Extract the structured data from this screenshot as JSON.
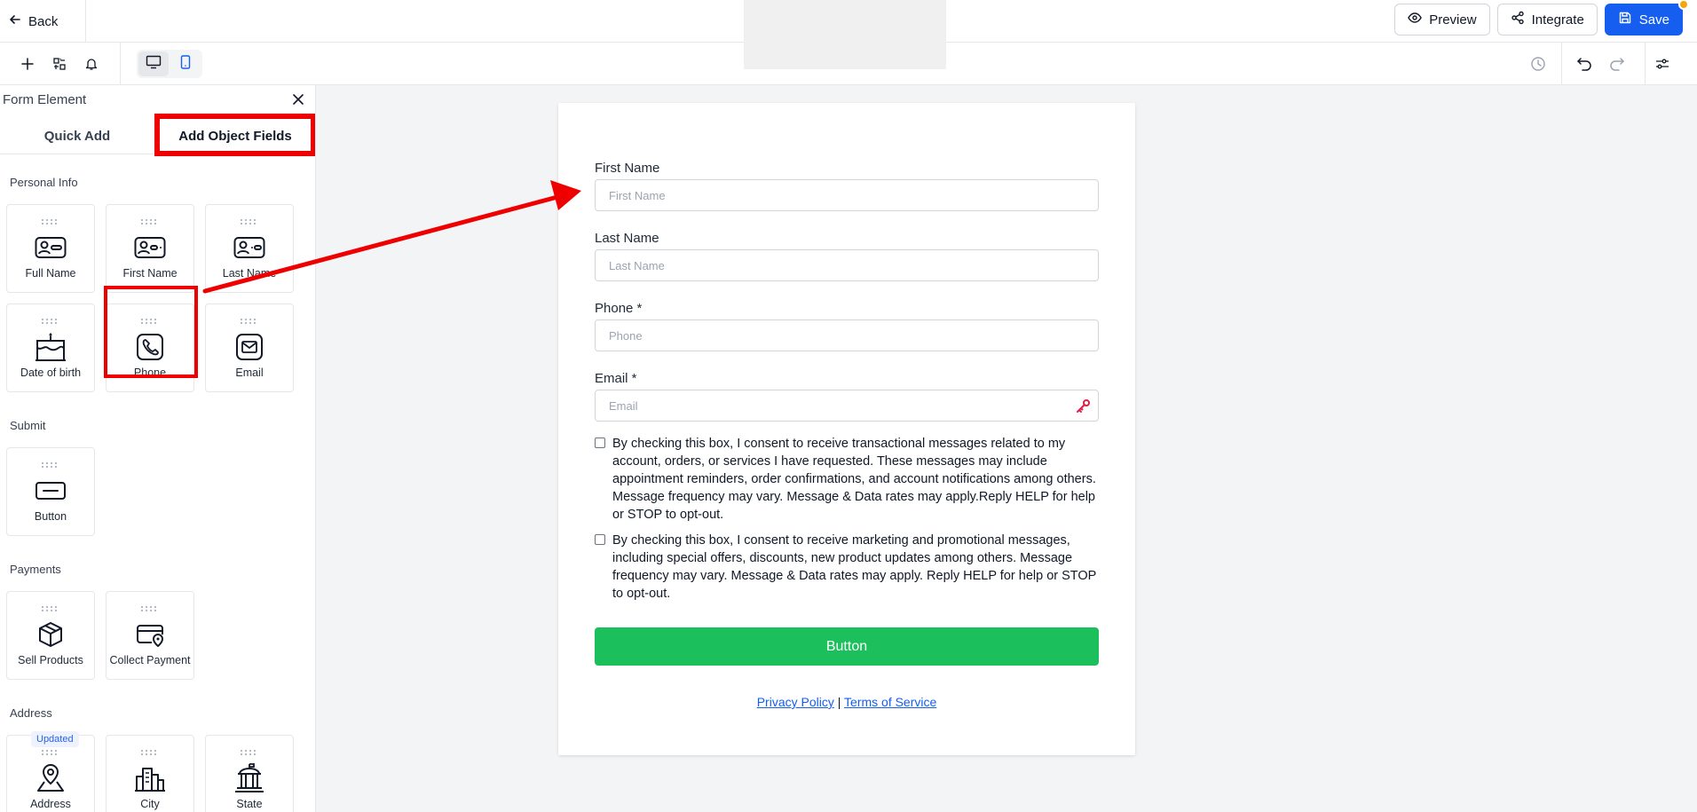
{
  "topbar": {
    "back_label": "Back",
    "preview_label": "Preview",
    "integrate_label": "Integrate",
    "save_label": "Save"
  },
  "sidebar": {
    "title": "Form Element",
    "tabs": [
      "Quick Add",
      "Add Object Fields"
    ],
    "active_tab": "Add Object Fields",
    "sections": {
      "personal": "Personal Info",
      "submit": "Submit",
      "payments": "Payments",
      "address": "Address"
    },
    "items": {
      "full_name": "Full Name",
      "first_name": "First Name",
      "last_name": "Last Name",
      "dob": "Date of birth",
      "phone": "Phone",
      "email": "Email",
      "button": "Button",
      "sell_products": "Sell Products",
      "collect_payment": "Collect Payment",
      "address": "Address",
      "city": "City",
      "state": "State"
    },
    "updated_badge": "Updated"
  },
  "form": {
    "first_name_label": "First Name",
    "first_name_placeholder": "First Name",
    "last_name_label": "Last Name",
    "last_name_placeholder": "Last Name",
    "phone_label": "Phone *",
    "phone_placeholder": "Phone",
    "email_label": "Email *",
    "email_placeholder": "Email",
    "consent_transactional": "By checking this box, I consent to receive transactional messages related to my account, orders, or services I have requested. These messages may include appointment reminders, order confirmations, and account notifications among others. Message frequency may vary. Message & Data rates may apply.Reply HELP for help or STOP to opt-out.",
    "consent_marketing": "By checking this box, I consent to receive marketing and promotional messages, including special offers, discounts, new product updates among others. Message frequency may vary. Message & Data rates may apply. Reply HELP for help or STOP to opt-out.",
    "button_label": "Button",
    "privacy_link": "Privacy Policy",
    "separator": "|",
    "terms_link": "Terms of Service"
  },
  "colors": {
    "accent": "#155eef",
    "submit_button": "#1bbf5c",
    "annotation": "#ef0000"
  }
}
